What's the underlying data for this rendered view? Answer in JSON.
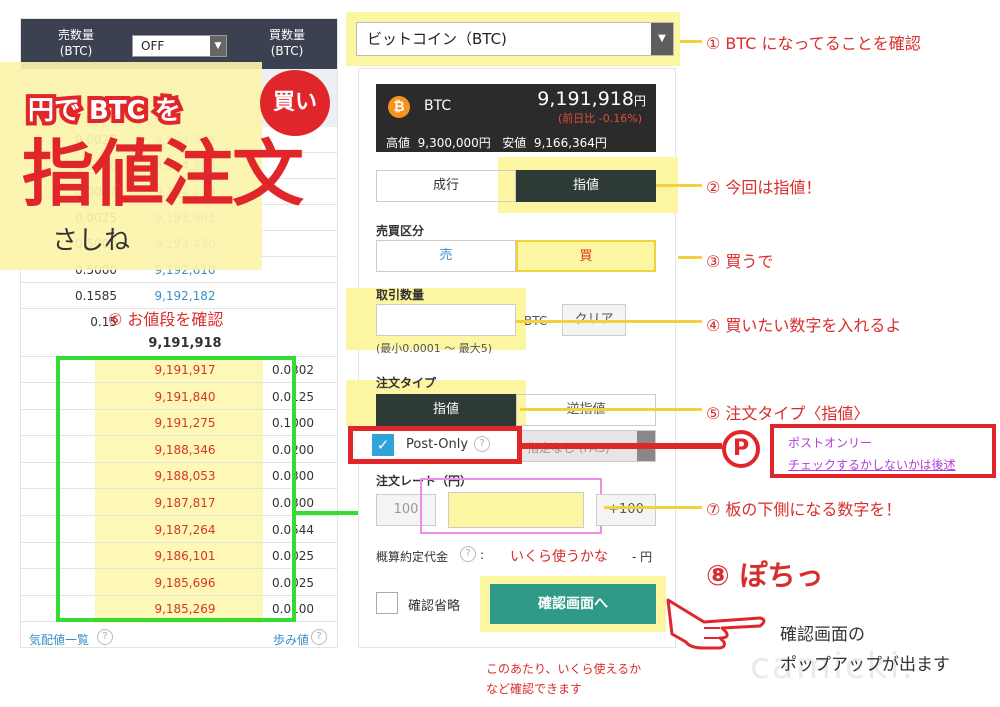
{
  "order_book": {
    "header": {
      "sell_label": "売数量\n(BTC)",
      "off_value": "OFF",
      "buy_label": "買数量\n(BTC)"
    },
    "sell_rows": [
      {
        "qty": "0.0025",
        "price": "9,194,318"
      },
      {
        "qty": "0.5000",
        "price": "9,194,280"
      },
      {
        "qty": "0.0097",
        "price": "9,194,179"
      },
      {
        "qty": "0.0025",
        "price": "9,193,901"
      },
      {
        "qty": "0.5000",
        "price": "9,193,430"
      },
      {
        "qty": "0.5000",
        "price": "9,192,610"
      },
      {
        "qty": "0.1585",
        "price": "9,192,182"
      },
      {
        "qty": "0.15",
        "price": ""
      }
    ],
    "mid_price": "9,191,918",
    "buy_rows": [
      {
        "price": "9,191,917",
        "qty": "0.0302"
      },
      {
        "price": "9,191,840",
        "qty": "0.0125"
      },
      {
        "price": "9,191,275",
        "qty": "0.1000"
      },
      {
        "price": "9,188,346",
        "qty": "0.0200"
      },
      {
        "price": "9,188,053",
        "qty": "0.0300"
      },
      {
        "price": "9,187,817",
        "qty": "0.0300"
      },
      {
        "price": "9,187,264",
        "qty": "0.0544"
      },
      {
        "price": "9,186,101",
        "qty": "0.0025"
      },
      {
        "price": "9,185,696",
        "qty": "0.0025"
      },
      {
        "price": "9,185,269",
        "qty": "0.0100"
      }
    ],
    "footer_left": "気配値一覧",
    "footer_right": "歩み値"
  },
  "banner": {
    "line1": "円で BTC を",
    "badge": "買い",
    "big": "指値注文",
    "sub": "さしね"
  },
  "order_panel": {
    "coin": "ビットコイン（BTC)",
    "ticker": {
      "symbol": "BTC",
      "price": "9,191,918",
      "unit": "円",
      "change": "(前日比 -0.16%)",
      "high_label": "高値",
      "high": "9,300,000円",
      "low_label": "安値",
      "low": "9,166,364円"
    },
    "mode_tabs": [
      "成行",
      "指値"
    ],
    "side_label": "売買区分",
    "side_tabs": [
      "売",
      "買"
    ],
    "qty_label": "取引数量",
    "qty_unit": "BTC",
    "clear_button": "クリア",
    "qty_hint": "(最小0.0001 ～ 最大5)",
    "order_type_label": "注文タイプ",
    "order_type_tabs": [
      "指値",
      "逆指値"
    ],
    "post_only": "Post-Only",
    "expiry": "指定なし (FAS)",
    "rate_label": "注文レート（円）",
    "minus": "100",
    "plus": "+100",
    "estimate_label": "概算約定代金",
    "estimate_hint": "いくら使うかな",
    "estimate_value": "- 円",
    "skip_confirm": "確認省略",
    "confirm_button": "確認画面へ"
  },
  "annotations": {
    "a1": "① BTC になってることを確認",
    "a2": "② 今回は指値！",
    "a3": "③ 買うで",
    "a4": "④ 買いたい数字を入れるよ",
    "a5": "⑤ 注文タイプ〈指値〉",
    "a6": "⑥ お値段を確認",
    "a7": "⑦ 板の下側になる数字を！",
    "a8": "⑧ ぽちっ",
    "p_mark": "P",
    "p_note1": "ポストオンリー",
    "p_note2": "チェックするかしないかは後述",
    "confirm_note1": "確認画面の",
    "confirm_note2": "ポップアップが出ます",
    "estimate_note1": "このあたり、いくら使えるか",
    "estimate_note2": "など確認できます",
    "watermark": "camicki."
  },
  "colors": {
    "accent_red": "#e0262b",
    "highlight_yellow": "#fcf5a1",
    "green_box": "#33dd33",
    "teal_button": "#2f9a88"
  }
}
